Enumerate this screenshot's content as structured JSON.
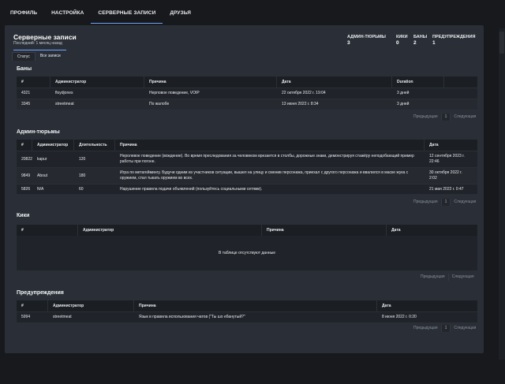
{
  "nav": {
    "tabs": [
      {
        "label": "ПРОФИЛЬ"
      },
      {
        "label": "НАСТРОЙКА"
      },
      {
        "label": "СЕРВЕРНЫЕ ЗАПИСИ"
      },
      {
        "label": "ДРУЗЬЯ"
      }
    ],
    "active": "СЕРВЕРНЫЕ ЗАПИСИ",
    "accent": "#6fa3ff"
  },
  "page": {
    "title": "Серверные записи",
    "subtitle": "Последний: 1 месяц назад"
  },
  "stats": [
    {
      "label": "АДМИН-ТЮРЬМЫ",
      "value": "3"
    },
    {
      "label": "КИКИ",
      "value": "0"
    },
    {
      "label": "БАНЫ",
      "value": "2"
    },
    {
      "label": "ПРЕДУПРЕЖДЕНИЯ",
      "value": "1"
    }
  ],
  "subtabs": [
    {
      "label": "Статус"
    },
    {
      "label": "Все записи"
    }
  ],
  "pager": {
    "prev": "Предыдущая",
    "next": "Следующая",
    "page": "1"
  },
  "bans": {
    "title": "Баны",
    "columns": [
      "#",
      "Администратор",
      "Причина",
      "Дата",
      "Duration"
    ],
    "rows": [
      [
        "4321",
        "floydjones",
        "Нерповое поведение, VOIP",
        "22 октября 2022 г. 19:04",
        "3 дней"
      ],
      [
        "3345",
        "streetmeat",
        "По жалобе",
        "13 июня 2022 г. 8:34",
        "3 дней"
      ]
    ]
  },
  "jails": {
    "title": "Админ-тюрьмы",
    "columns": [
      "#",
      "Администратор",
      "Длительность",
      "Причина",
      "Дата"
    ],
    "rows": [
      [
        "20822",
        "kapur",
        "120",
        "Неролевое поведение (вождение). Во время преследования за человеком врезается в столбы, дорожные знаки, демонстрируя стажёру неподобающий пример работы при погоне.",
        "12 сентября 2023 г. 22:46"
      ],
      [
        "9849",
        "About",
        "180",
        "Игра по метагеймингу. Будучи одним из участников ситуации, вышел на улицу и сменив персонажа, приехал с другого персонажа и ввалился в маске жука с оружием, стал тыкать оружием во всех.",
        "30 октября 2022 г. 2:02"
      ],
      [
        "5826",
        "N/A",
        "60",
        "Нарушение правила подачи объявлений (пользуйтесь социальными сетями).",
        "21 мая 2022 г. 0:47"
      ]
    ]
  },
  "kicks": {
    "title": "Кики",
    "columns": [
      "#",
      "Администратор",
      "Причина",
      "Дата"
    ],
    "empty": "В таблице отсутствуют данные"
  },
  "warnings": {
    "title": "Предупреждения",
    "columns": [
      "#",
      "Администратор",
      "Причина",
      "Дата"
    ],
    "rows": [
      [
        "5994",
        "streetmeat",
        "Язык в правила использования чатов (\"Ты шо ебанутый?\"",
        "8 июня 2022 г. 0:20"
      ]
    ]
  }
}
